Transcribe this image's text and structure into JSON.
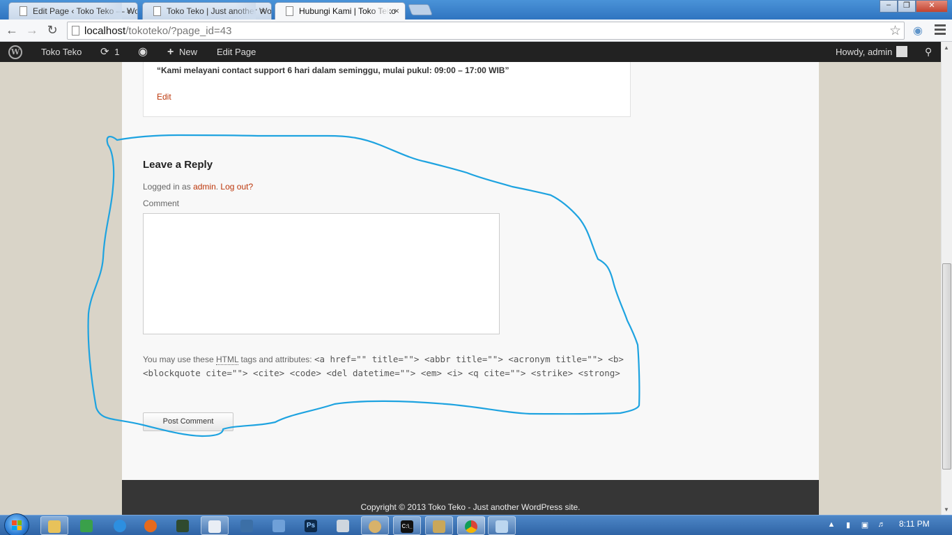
{
  "browser": {
    "tabs": [
      {
        "title": "Edit Page ‹ Toko Teko — WordPress",
        "active": false
      },
      {
        "title": "Toko Teko | Just another WordPress site",
        "active": false
      },
      {
        "title": "Hubungi Kami | Toko Teko",
        "active": true
      }
    ],
    "close_glyph": "×",
    "url_host": "localhost",
    "url_path": "/tokoteko/?page_id=43",
    "window_controls": [
      "–",
      "❐",
      "✕"
    ]
  },
  "adminbar": {
    "logo_letter": "W",
    "site_name": "Toko Teko",
    "updates_count": "1",
    "new_label": "New",
    "edit_page_label": "Edit Page",
    "howdy": "Howdy, admin"
  },
  "entry": {
    "quote": "“Kami melayani contact support 6 hari dalam seminggu, mulai pukul: 09:00 – 17:00 WIB”",
    "edit_link": "Edit"
  },
  "comment_form": {
    "title": "Leave a Reply",
    "logged_in_prefix": "Logged in as ",
    "user_link": "admin",
    "logout_link": "Log out?",
    "comment_label": "Comment",
    "comment_value": "",
    "allowed_prefix": "You may use these ",
    "allowed_abbr": "HTML",
    "allowed_suffix": " tags and attributes: ",
    "allowed_tags": "<a href=\"\" title=\"\"> <abbr title=\"\"> <acronym title=\"\"> <b> <blockquote cite=\"\"> <cite> <code> <del datetime=\"\"> <em> <i> <q cite=\"\"> <strike> <strong>",
    "submit_label": "Post Comment"
  },
  "footer": {
    "copyright": "Copyright © 2013 Toko Teko - Just another WordPress site."
  },
  "taskbar": {
    "clock": "8:11 PM",
    "ps_label": "Ps",
    "cmd_label": "C:\\_"
  },
  "colors": {
    "link": "#bc360a",
    "annotation": "#1ea3e0",
    "adminbar": "#222222",
    "footer": "#363636"
  }
}
